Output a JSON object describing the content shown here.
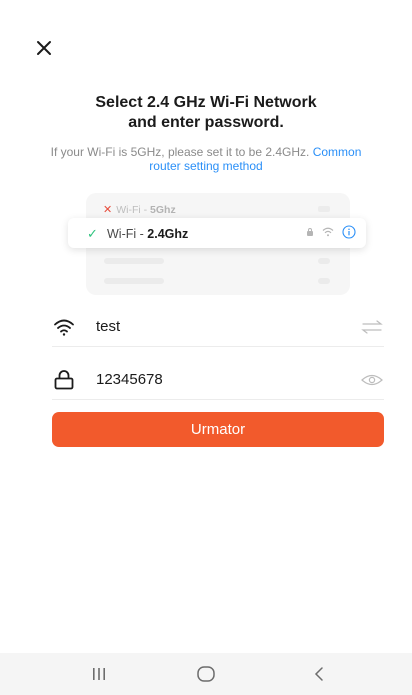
{
  "header": {
    "close_icon": "close-icon"
  },
  "title_lines": [
    "Select 2.4 GHz Wi-Fi Network",
    "and enter password."
  ],
  "subtitle": {
    "text": "If your Wi-Fi is 5GHz, please set it to be 2.4GHz.",
    "link": "Common router setting method"
  },
  "illustration": {
    "network_5g": {
      "prefix": "Wi-Fi - ",
      "band": "5Ghz",
      "status_icon": "cross-icon"
    },
    "network_24g": {
      "prefix": "Wi-Fi - ",
      "band": "2.4Ghz",
      "status_icon": "check-icon",
      "icons": [
        "lock-icon",
        "wifi-icon",
        "info-icon"
      ]
    }
  },
  "form": {
    "ssid": {
      "value": "test",
      "icon": "wifi-icon",
      "action_icon": "switch-network-icon"
    },
    "password": {
      "value": "12345678",
      "icon": "lock-icon",
      "action_icon": "eye-icon"
    }
  },
  "primary_button": {
    "label": "Urmator"
  },
  "colors": {
    "accent": "#f25a2c",
    "link": "#2a8ff7",
    "success": "#2ec37e",
    "error": "#e74c3c"
  },
  "system_nav": {
    "items": [
      "recent-apps-icon",
      "home-icon",
      "back-icon"
    ]
  }
}
